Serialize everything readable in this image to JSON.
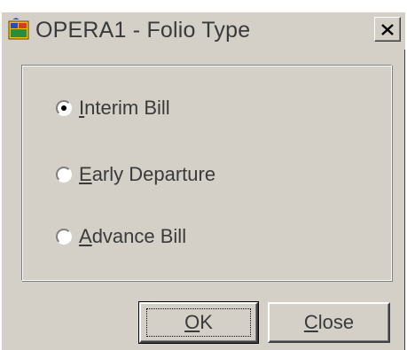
{
  "window": {
    "title": "OPERA1 - Folio Type",
    "icon": "opera-app-icon",
    "close_icon": "close-x-icon"
  },
  "folio_type": {
    "selected": "Interim Bill",
    "options": [
      {
        "prefix": "",
        "mnemonic": "I",
        "rest": "nterim Bill",
        "checked": true
      },
      {
        "prefix": "",
        "mnemonic": "E",
        "rest": "arly Departure",
        "checked": false
      },
      {
        "prefix": "",
        "mnemonic": "A",
        "rest": "dvance Bill",
        "checked": false
      }
    ]
  },
  "buttons": {
    "ok": {
      "mnemonic": "O",
      "rest": "K"
    },
    "close": {
      "mnemonic": "C",
      "rest": "lose"
    }
  }
}
